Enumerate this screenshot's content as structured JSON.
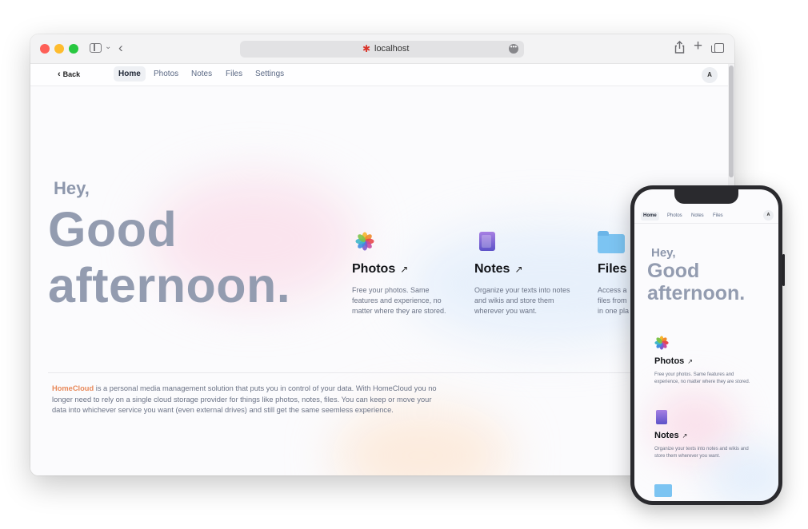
{
  "browser": {
    "url": "localhost",
    "accent_colors": {
      "close": "#fe5f57",
      "minimize": "#febc2e",
      "zoom": "#28c840"
    }
  },
  "nav": {
    "back_label": "Back",
    "tabs": [
      {
        "label": "Home",
        "active": true
      },
      {
        "label": "Photos",
        "active": false
      },
      {
        "label": "Notes",
        "active": false
      },
      {
        "label": "Files",
        "active": false
      },
      {
        "label": "Settings",
        "active": false
      }
    ],
    "avatar_initial": "A"
  },
  "greeting": {
    "hey": "Hey,",
    "line1": "Good",
    "line2": "afternoon."
  },
  "cards": [
    {
      "title": "Photos",
      "icon": "photos-icon",
      "description": "Free your photos. Same features and experience, no matter where they are stored."
    },
    {
      "title": "Notes",
      "icon": "notes-icon",
      "description": "Organize your texts into notes and wikis and store them wherever you want."
    },
    {
      "title": "Files",
      "icon": "folder-icon",
      "description_visible": [
        "Access a",
        "files from",
        "in one pla"
      ]
    }
  ],
  "about": {
    "brand": "HomeCloud",
    "text": " is a personal media management solution that puts you in control of your data. With HomeCloud you no longer need to rely on a single cloud storage provider for things like photos, notes, files. You can keep or move your data into whichever service you want (even external drives) and still get the same seemless experience."
  },
  "phone": {
    "tabs": [
      "Home",
      "Photos",
      "Notes",
      "Files"
    ],
    "avatar_initial": "A",
    "greeting": {
      "hey": "Hey,",
      "line1": "Good",
      "line2": "afternoon."
    },
    "cards": [
      {
        "title": "Photos",
        "description": "Free your photos. Same features and experience, no matter where they are stored."
      },
      {
        "title": "Notes",
        "description": "Organize your texts into notes and wikis and store them wherever you want."
      }
    ]
  },
  "icons": {
    "arrow": "↗",
    "back_chevron": "‹",
    "url_dots": "•••",
    "favicon": "✱",
    "share": "⇧",
    "plus": "+"
  }
}
